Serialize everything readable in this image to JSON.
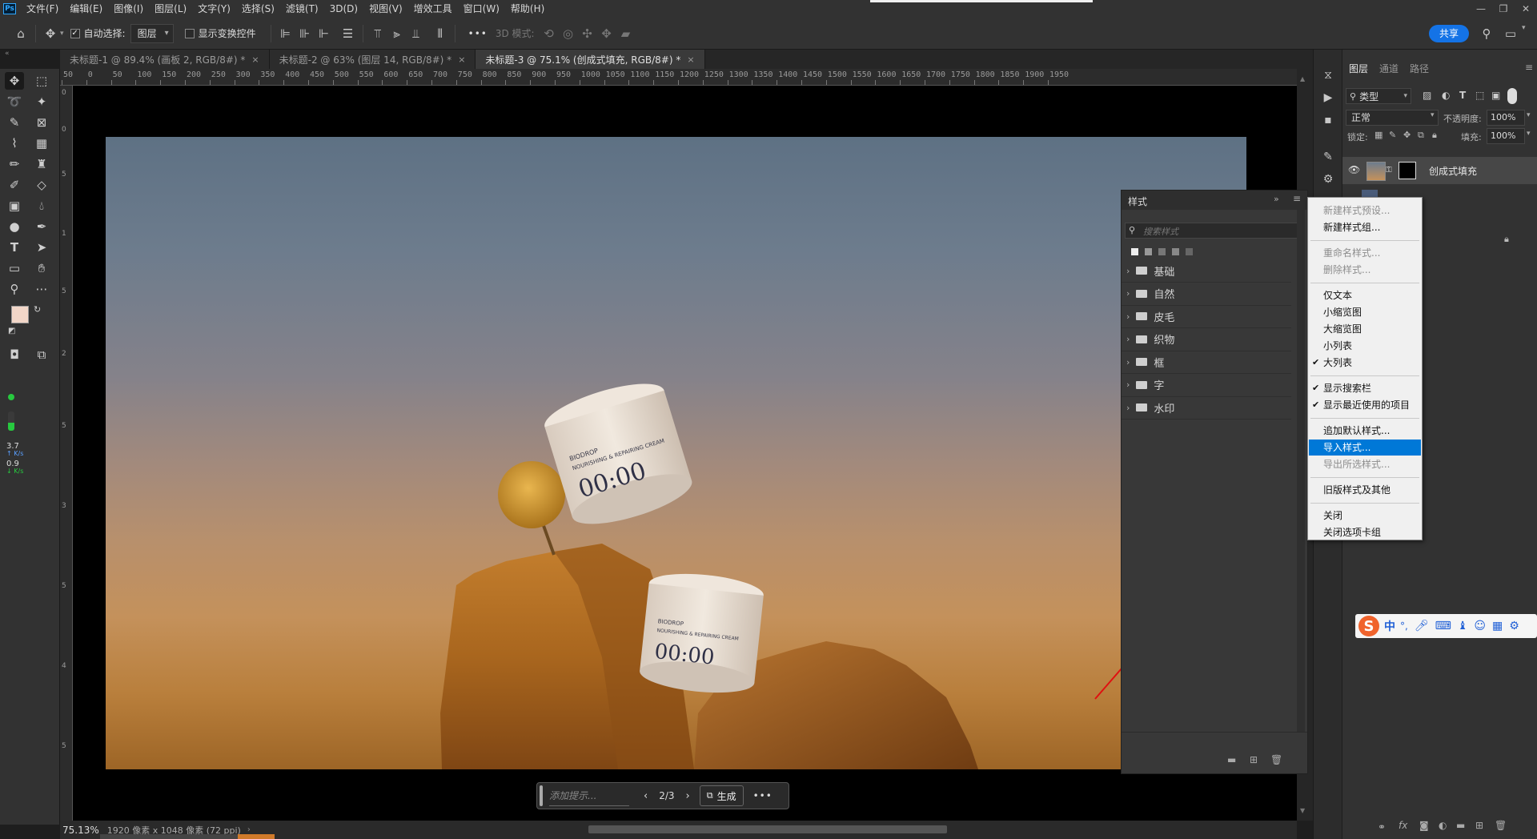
{
  "app": {
    "logo": "Ps",
    "menu": [
      "文件(F)",
      "编辑(E)",
      "图像(I)",
      "图层(L)",
      "文字(Y)",
      "选择(S)",
      "滤镜(T)",
      "3D(D)",
      "视图(V)",
      "增效工具",
      "窗口(W)",
      "帮助(H)"
    ]
  },
  "options_bar": {
    "auto_select_label": "自动选择:",
    "auto_select_checked": true,
    "auto_select_target": "图层",
    "show_transform_label": "显示变换控件",
    "more_label": "•••",
    "mode_3d_label": "3D 模式:",
    "share_label": "共享"
  },
  "tabs": [
    {
      "label": "未标题-1 @ 89.4% (画板 2, RGB/8#) *",
      "close": "×"
    },
    {
      "label": "未标题-2 @ 63% (图层 14, RGB/8#) *",
      "close": "×"
    },
    {
      "label": "未标题-3 @ 75.1% (创成式填充, RGB/8#) *",
      "close": "×"
    }
  ],
  "ruler": {
    "marks": [
      "50",
      "0",
      "50",
      "100",
      "150",
      "200",
      "250",
      "300",
      "350",
      "400",
      "450",
      "500",
      "550",
      "600",
      "650",
      "700",
      "750",
      "800",
      "850",
      "900",
      "950",
      "1000",
      "1050",
      "1100",
      "1150",
      "1200",
      "1250",
      "1300",
      "1350",
      "1400",
      "1450",
      "1500",
      "1550",
      "1600",
      "1650",
      "1700",
      "1750",
      "1800",
      "1850",
      "1900",
      "1950"
    ]
  },
  "toolbar": {
    "net_speed": {
      "up_value": "3.7",
      "up_unit": "K/s",
      "down_value": "0.9",
      "down_unit": "K/s"
    },
    "foreground_color": "#f2d6c8",
    "background_color": "#ffffff"
  },
  "product": {
    "brand": "BIODROP",
    "line": "NOURISHING & REPAIRING CREAM",
    "name": "00:00"
  },
  "prompt_bar": {
    "placeholder": "添加提示...",
    "page": "2/3",
    "generate_label": "生成",
    "more": "•••"
  },
  "status_bar": {
    "zoom": "75.13%",
    "doc_info": "1920 像素 x 1048 像素 (72 ppi)"
  },
  "layers_panel": {
    "tabs": [
      "图层",
      "通道",
      "路径"
    ],
    "filter_kind": "类型",
    "blend_mode": "正常",
    "opacity_label": "不透明度:",
    "opacity_value": "100%",
    "lock_label": "锁定:",
    "fill_label": "填充:",
    "fill_value": "100%",
    "layers": [
      {
        "name": "创成式填充",
        "visible": true
      }
    ]
  },
  "styles_panel": {
    "title": "样式",
    "search_placeholder": "搜索样式",
    "groups": [
      "基础",
      "自然",
      "皮毛",
      "织物",
      "框",
      "字",
      "水印"
    ]
  },
  "context_menu": {
    "items": [
      {
        "label": "新建样式预设...",
        "disabled": true
      },
      {
        "label": "新建样式组...",
        "disabled": false
      },
      {
        "separator": true
      },
      {
        "label": "重命名样式...",
        "disabled": true
      },
      {
        "label": "删除样式...",
        "disabled": true
      },
      {
        "separator": true
      },
      {
        "label": "仅文本",
        "disabled": false
      },
      {
        "label": "小缩览图",
        "disabled": false
      },
      {
        "label": "大缩览图",
        "disabled": false
      },
      {
        "label": "小列表",
        "disabled": false
      },
      {
        "label": "大列表",
        "checked": true
      },
      {
        "separator": true
      },
      {
        "label": "显示搜索栏",
        "checked": true
      },
      {
        "label": "显示最近使用的项目",
        "checked": true
      },
      {
        "separator": true
      },
      {
        "label": "追加默认样式...",
        "disabled": false
      },
      {
        "label": "导入样式...",
        "highlighted": true
      },
      {
        "label": "导出所选样式...",
        "disabled": true
      },
      {
        "separator": true
      },
      {
        "label": "旧版样式及其他",
        "disabled": false
      },
      {
        "separator": true
      },
      {
        "label": "关闭",
        "disabled": false
      },
      {
        "label": "关闭选项卡组",
        "disabled": false
      }
    ]
  },
  "ime_bar": {
    "logo": "S",
    "mode": "中",
    "punct": "°,"
  },
  "colors": {
    "accent": "#1473e6",
    "highlight": "#0078d7",
    "annotation_arrow": "#e01010"
  }
}
